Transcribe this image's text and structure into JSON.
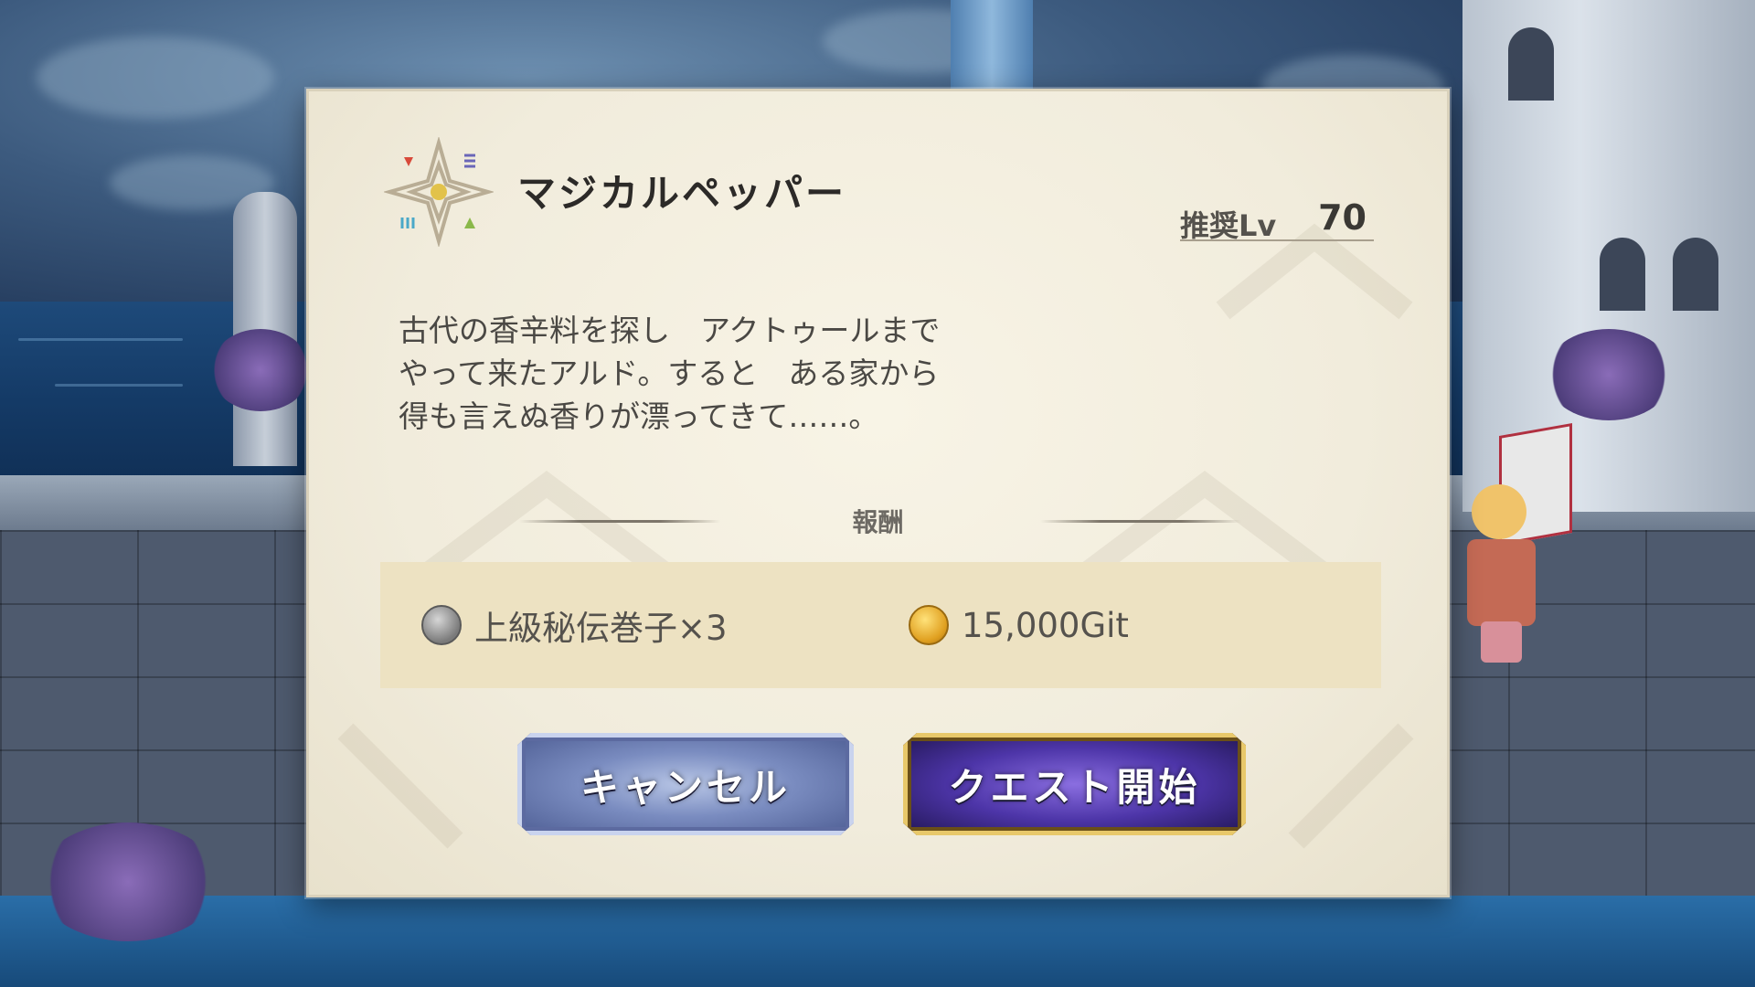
{
  "quest": {
    "title": "マジカルペッパー",
    "level_label": "推奨Lv",
    "level_value": "70",
    "description": "古代の香辛料を探し　アクトゥールまで\nやって来たアルド。すると　ある家から\n得も言えぬ香りが漂ってきて……。"
  },
  "rewards": {
    "header": "報酬",
    "items": [
      {
        "icon": "scroll-icon",
        "label": "上級秘伝巻子×3"
      },
      {
        "icon": "coin-icon",
        "label": "15,000Git"
      }
    ]
  },
  "buttons": {
    "cancel": "キャンセル",
    "start": "クエスト開始"
  },
  "colors": {
    "dialog_bg": "#f1ecdc",
    "reward_panel": "#ede2c2",
    "cancel_button": "#7a8cc0",
    "start_button": "#4d35a8",
    "start_border": "#e8c86a"
  }
}
